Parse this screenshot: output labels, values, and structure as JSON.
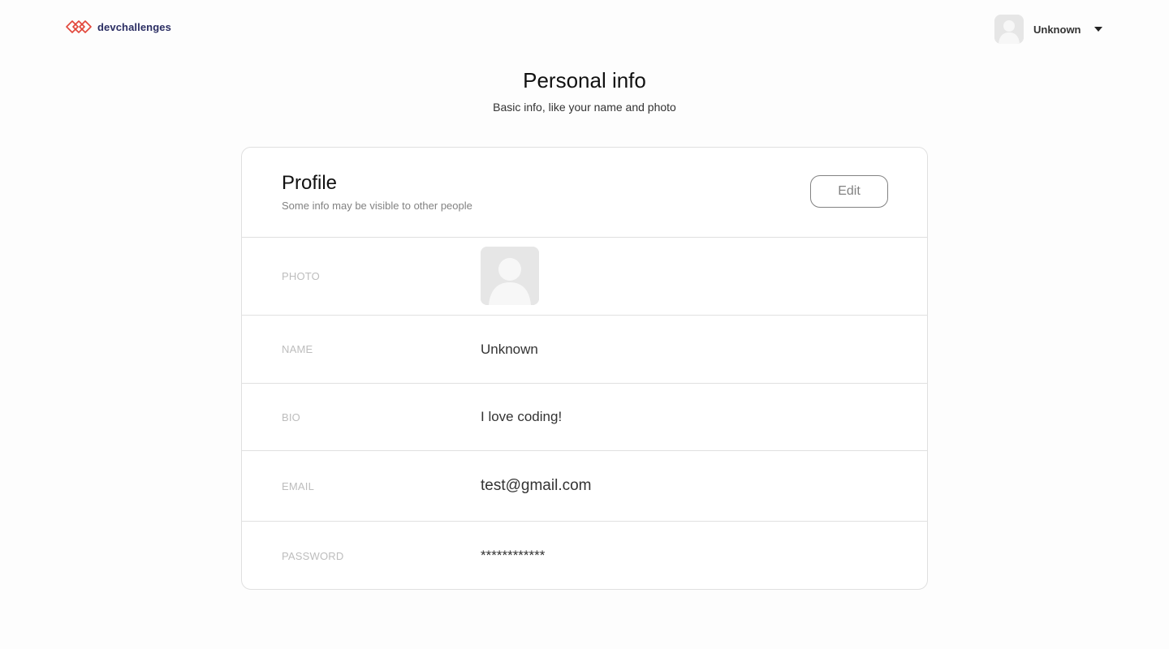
{
  "header": {
    "logo_text": "devchallenges",
    "user": {
      "name": "Unknown",
      "avatar_icon": "avatar-placeholder-icon",
      "menu_icon": "caret-down-icon"
    }
  },
  "page": {
    "title": "Personal info",
    "subtitle": "Basic info, like your name and photo"
  },
  "profile": {
    "title": "Profile",
    "subtitle": "Some info may be visible to other people",
    "edit_label": "Edit",
    "fields": {
      "photo_label": "PHOTO",
      "name_label": "NAME",
      "name_value": "Unknown",
      "bio_label": "BIO",
      "bio_value": "I love coding!",
      "email_label": "EMAIL",
      "email_value": "test@gmail.com",
      "password_label": "PASSWORD",
      "password_value": "************"
    }
  },
  "colors": {
    "brand_text": "#2b2e63",
    "brand_logo": "#e2463a",
    "label": "#bdbdbd",
    "muted": "#828282",
    "border": "#e0e0e0"
  }
}
